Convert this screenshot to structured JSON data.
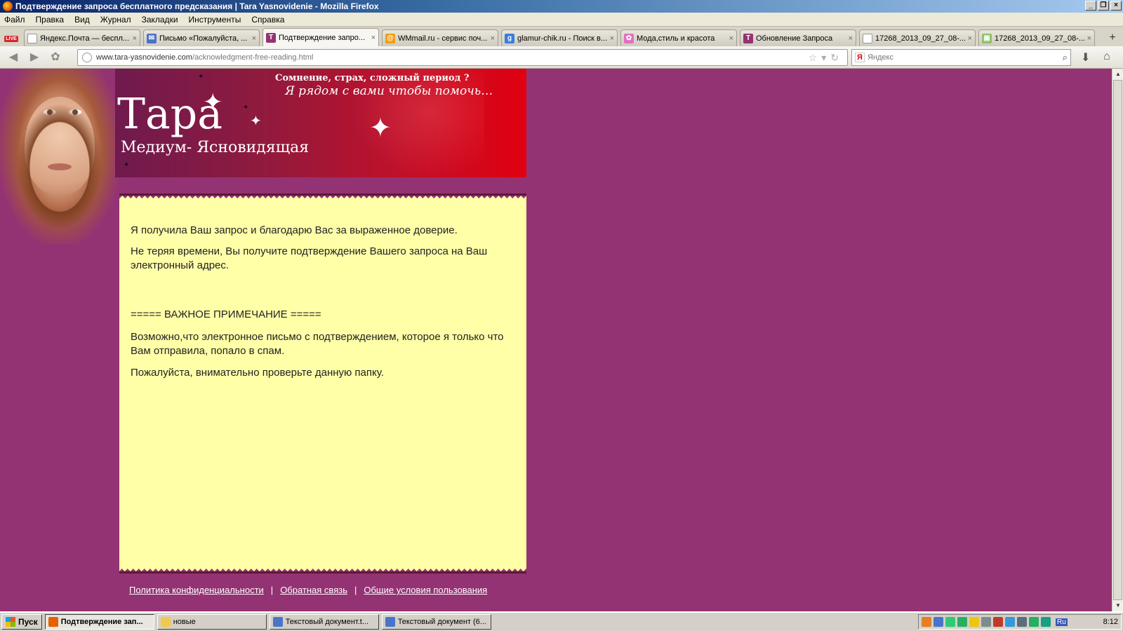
{
  "window": {
    "title": "Подтверждение запроса бесплатного предсказания | Tara Yasnovidenie - Mozilla Firefox",
    "buttons": [
      "_",
      "❐",
      "×"
    ]
  },
  "menu": [
    "Файл",
    "Правка",
    "Вид",
    "Журнал",
    "Закладки",
    "Инструменты",
    "Справка"
  ],
  "tabs": [
    {
      "label": "Яндекс.Почта — беспл...",
      "icon_color": "#ffffff",
      "icon_char": ""
    },
    {
      "label": "Письмо «Пожалуйста, ...",
      "icon_color": "#4a74c9",
      "icon_char": "✉"
    },
    {
      "label": "Подтверждение запро...",
      "icon_color": "#943373",
      "icon_char": "T"
    },
    {
      "label": "WMmail.ru - сервис поч...",
      "icon_color": "#f39c12",
      "icon_char": "@"
    },
    {
      "label": "glamur-chik.ru - Поиск в...",
      "icon_color": "#3b7ddd",
      "icon_char": "g"
    },
    {
      "label": "Мода,стиль и красота",
      "icon_color": "#e46fc0",
      "icon_char": "✿"
    },
    {
      "label": "Обновление Запроса",
      "icon_color": "#943373",
      "icon_char": "T"
    },
    {
      "label": "17268_2013_09_27_08-...",
      "icon_color": "#ffffff",
      "icon_char": ""
    },
    {
      "label": "17268_2013_09_27_08-...",
      "icon_color": "#8fbf6a",
      "icon_char": "▣"
    }
  ],
  "tab_close": "×",
  "new_tab": "+",
  "live_badge": "LIVE",
  "nav": {
    "url_host": "www.tara-yasnovidenie.com",
    "url_path": "/acknowledgment-free-reading.html",
    "search_placeholder": "Яндекс",
    "search_engine_letter": "Я"
  },
  "banner": {
    "tagline1": "Сомнение, страх, сложный период ?",
    "tagline2": "Я рядом с вами чтобы помочь…",
    "brand": "Тара",
    "subbrand": "Медиум- Ясновидящая"
  },
  "content": {
    "p1": "Я получила Ваш запрос и благодарю Вас за выраженное доверие.",
    "p2": "Не теряя времени, Вы получите подтверждение Вашего запроса на Ваш электронный адрес.",
    "p3": "===== ВАЖНОЕ ПРИМЕЧАНИЕ =====",
    "p4": "Возможно,что электронное письмо с подтверждением, которое я только что Вам отправила, попало в спам.",
    "p5": "Пожалуйста, внимательно проверьте данную папку."
  },
  "footer": {
    "links": [
      "Политика конфиденциальности",
      "Обратная связь",
      "Общие условия пользования"
    ],
    "separator": "|"
  },
  "taskbar": {
    "start": "Пуск",
    "items": [
      {
        "label": "Подтверждение зап...",
        "active": true,
        "icon_color": "#e66000"
      },
      {
        "label": "новые",
        "active": false,
        "icon_color": "#f2c94c"
      },
      {
        "label": "Текстовый документ.t...",
        "active": false,
        "icon_color": "#4a74c9"
      },
      {
        "label": "Текстовый документ (6...",
        "active": false,
        "icon_color": "#4a74c9"
      }
    ],
    "lang": "Ru",
    "clock": "8:12",
    "tray_colors": [
      "#e67e22",
      "#4a74c9",
      "#2ecc71",
      "#27ae60",
      "#f1c40f",
      "#7f8c8d",
      "#c0392b",
      "#3498db",
      "#5d6d7e",
      "#27ae60",
      "#16a085"
    ]
  }
}
